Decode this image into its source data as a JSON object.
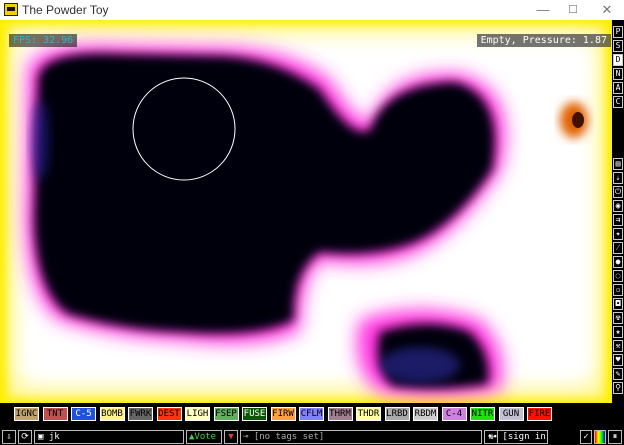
{
  "window": {
    "title": "The Powder Toy",
    "minimize": "—",
    "maximize": "☐",
    "close": "✕"
  },
  "overlay": {
    "fps": "FPS: 32.96",
    "pressure": "Empty, Pressure: 1.87"
  },
  "side_menu": {
    "top": [
      "P",
      "S",
      "D",
      "N",
      "A",
      "C"
    ],
    "active_index": 2,
    "icons": [
      "display-mode-icon",
      "electronics-icon",
      "power-icon",
      "sensors-icon",
      "force-icon",
      "explosive-icon",
      "powder-icon",
      "liquid-icon",
      "gas-icon",
      "solid-icon",
      "special-icon",
      "radioactive-icon",
      "life-icon",
      "tool-icon",
      "favorites-icon",
      "decoration-icon"
    ]
  },
  "elements": [
    {
      "label": "IGNC",
      "bg": "#c1a46d",
      "fg": "#000000"
    },
    {
      "label": "TNT",
      "bg": "#c05050",
      "fg": "#000000"
    },
    {
      "label": "C-5",
      "bg": "#2050e0",
      "fg": "#ffffff"
    },
    {
      "label": "BOMB",
      "bg": "#fff288",
      "fg": "#000000"
    },
    {
      "label": "FWRK",
      "bg": "#666666",
      "fg": "#000000"
    },
    {
      "label": "DEST",
      "bg": "#ff3311",
      "fg": "#000000"
    },
    {
      "label": "LIGH",
      "bg": "#ffffc0",
      "fg": "#000000"
    },
    {
      "label": "FSEP",
      "bg": "#63ad5f",
      "fg": "#000000"
    },
    {
      "label": "FUSE",
      "bg": "#0a5706",
      "fg": "#ffffff"
    },
    {
      "label": "FIRW",
      "bg": "#ffa040",
      "fg": "#000000"
    },
    {
      "label": "CFLM",
      "bg": "#8080ff",
      "fg": "#000000"
    },
    {
      "label": "THRM",
      "bg": "#a08090",
      "fg": "#000000"
    },
    {
      "label": "THDR",
      "bg": "#ffffa0",
      "fg": "#000000"
    },
    {
      "label": "LRBD",
      "bg": "#aaaaaa",
      "fg": "#000000"
    },
    {
      "label": "RBDM",
      "bg": "#cccccc",
      "fg": "#000000"
    },
    {
      "label": "C-4",
      "bg": "#d080e0",
      "fg": "#000000"
    },
    {
      "label": "NITR",
      "bg": "#20e010",
      "fg": "#000000"
    },
    {
      "label": "GUN",
      "bg": "#c0c0d0",
      "fg": "#000000"
    },
    {
      "label": "FIRE",
      "bg": "#ff1000",
      "fg": "#000000"
    }
  ],
  "bottom": {
    "save_name": "jk",
    "vote_label": "Vote",
    "tags_placeholder": "[no tags set]",
    "sign_in": "[sign in]"
  }
}
